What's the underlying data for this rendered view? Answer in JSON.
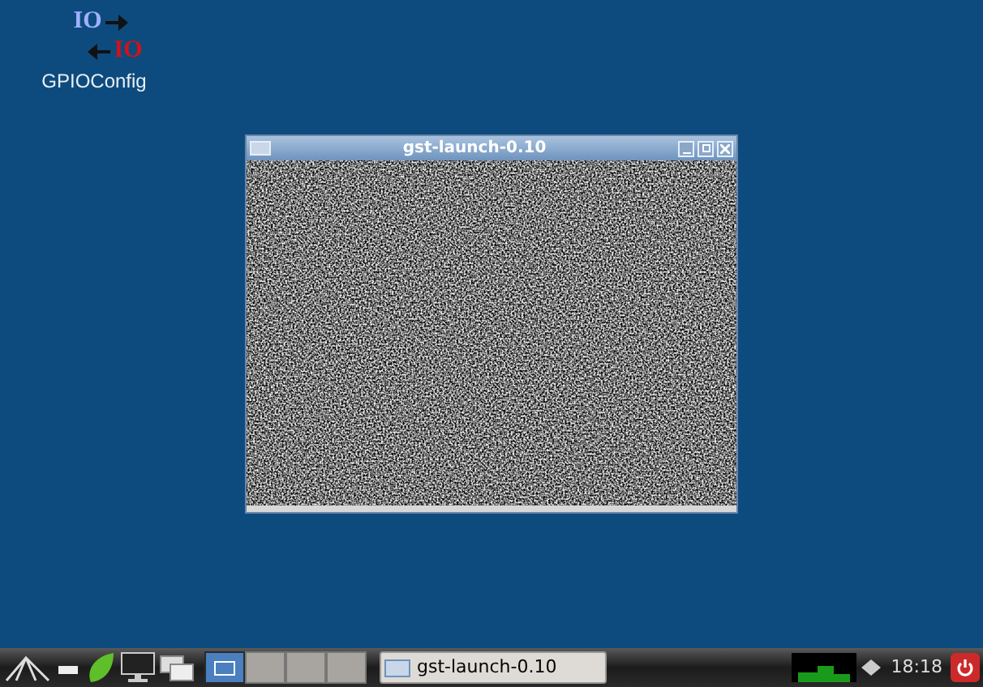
{
  "desktop_icons": [
    {
      "label": "GPIOConfig",
      "glyph_top": "IO",
      "glyph_bottom": "IO"
    }
  ],
  "window": {
    "title": "gst-launch-0.10"
  },
  "taskbar": {
    "desktops": [
      {
        "selected": true
      },
      {
        "selected": false
      },
      {
        "selected": false
      },
      {
        "selected": false
      }
    ],
    "tasks": [
      {
        "label": "gst-launch-0.10"
      }
    ],
    "clock": "18:18"
  }
}
